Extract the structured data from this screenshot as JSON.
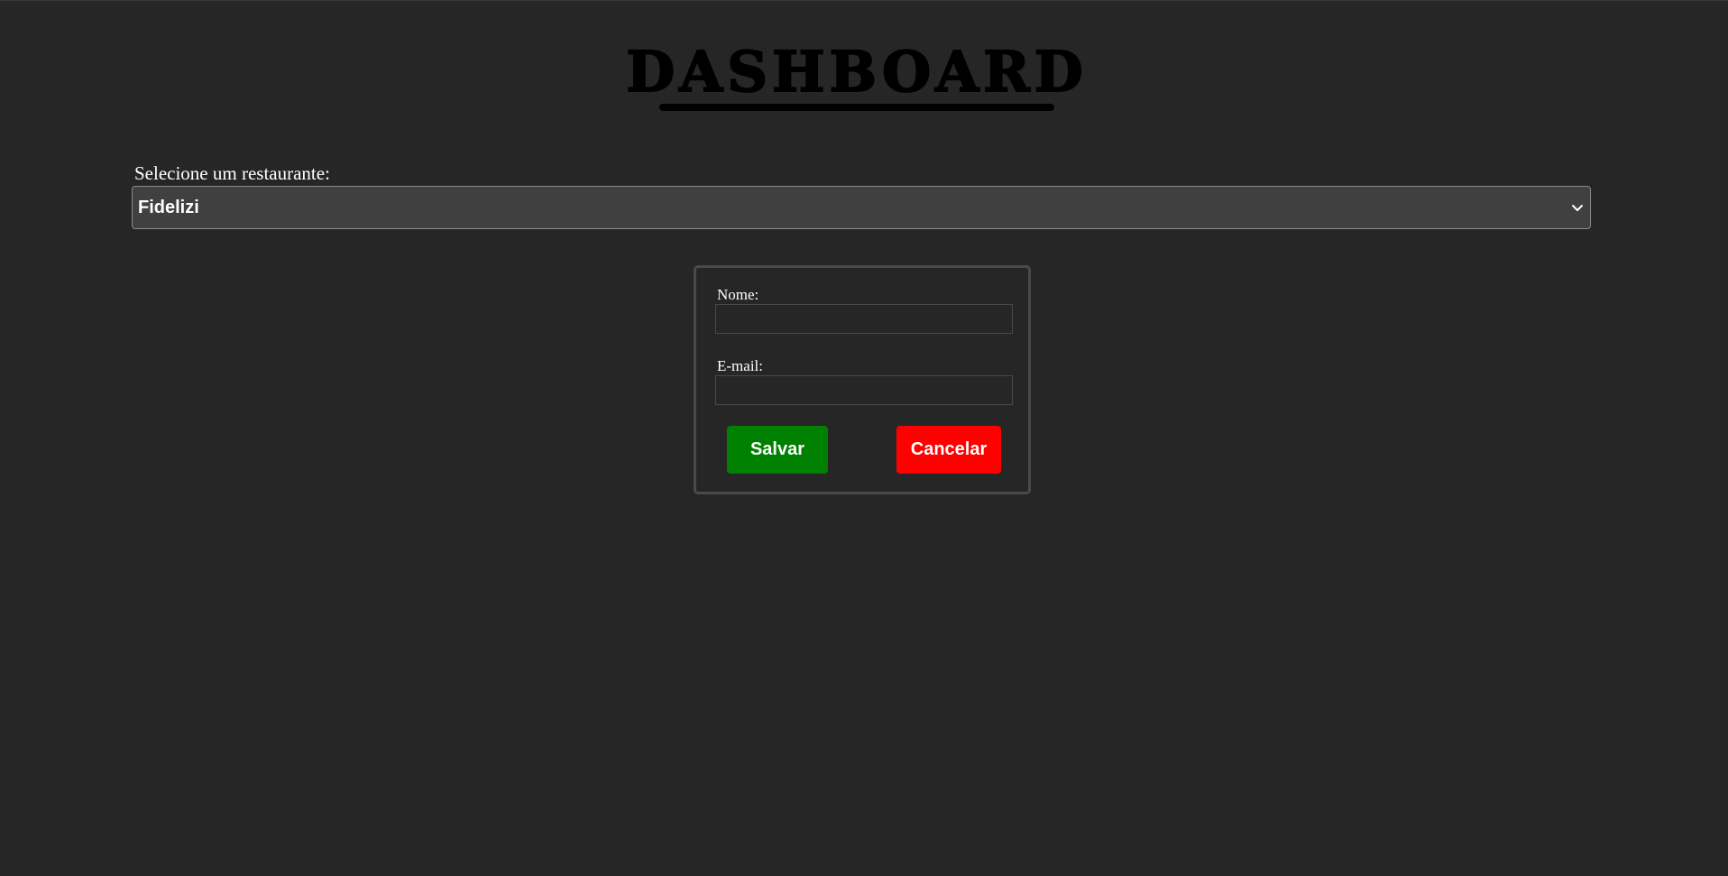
{
  "header": {
    "title": "DASHBOARD"
  },
  "restaurant_select": {
    "label": "Selecione um restaurante:",
    "selected_value": "Fidelizi"
  },
  "form": {
    "name_label": "Nome:",
    "name_value": "",
    "email_label": "E-mail:",
    "email_value": "",
    "save_label": "Salvar",
    "cancel_label": "Cancelar"
  },
  "colors": {
    "background": "#262626",
    "save_button": "#008000",
    "cancel_button": "#ff0000",
    "select_background": "#404040"
  }
}
